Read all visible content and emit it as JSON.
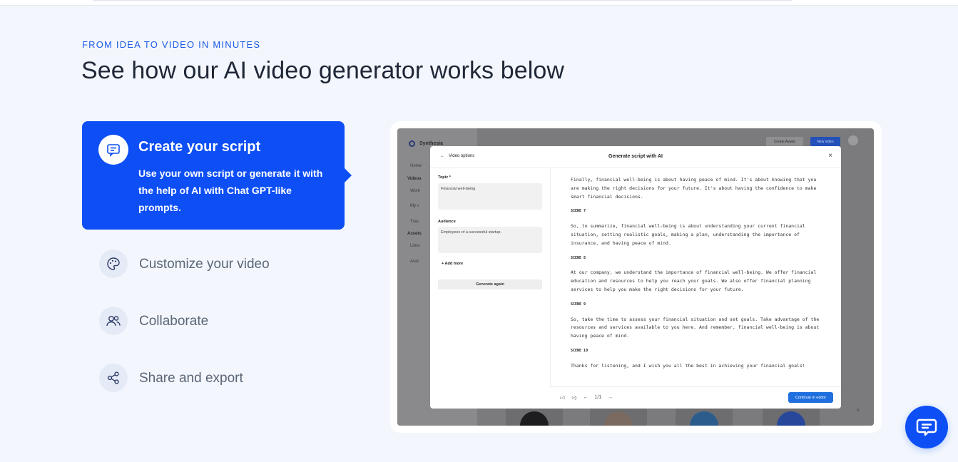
{
  "section": {
    "eyebrow": "FROM IDEA TO VIDEO IN MINUTES",
    "headline": "See how our AI video generator works below"
  },
  "steps": [
    {
      "title": "Create your script",
      "description": "Use your own script or generate it with the help of AI with Chat GPT-like prompts.",
      "icon": "script-message-icon",
      "active": true
    },
    {
      "title": "Customize your video",
      "icon": "palette-icon",
      "active": false
    },
    {
      "title": "Collaborate",
      "icon": "users-icon",
      "active": false
    },
    {
      "title": "Share and export",
      "icon": "share-icon",
      "active": false
    }
  ],
  "mockup": {
    "app_name": "Synthesia",
    "sidebar": {
      "home": "Home",
      "videos_heading": "Videos",
      "workspace": "Work",
      "my_videos": "My v",
      "trash": "Tras",
      "assets_heading": "Assets",
      "library": "Libra",
      "avatars": "Avat"
    },
    "header": {
      "create_avatar": "Create Avatar",
      "new_video": "New video"
    },
    "modal": {
      "back_label": "Video options",
      "title": "Generate script with AI",
      "close": "×",
      "topic_label": "Topic *",
      "topic_value": "Financial well-being",
      "audience_label": "Audience",
      "audience_value": "Employees of a successful startup.",
      "add_more": "Add more",
      "generate_again": "Generate again",
      "script": [
        {
          "type": "para",
          "text": "Finally, financial well-being is about having peace of mind. It's about knowing that you are making the right decisions for your future. It's about having the confidence to make smart financial decisions."
        },
        {
          "type": "scene",
          "text": "SCENE 7"
        },
        {
          "type": "para",
          "text": "So, to summarize, financial well-being is about understanding your current financial situation, setting realistic goals, making a plan, understanding the importance of insurance, and having peace of mind."
        },
        {
          "type": "scene",
          "text": "SCENE 8"
        },
        {
          "type": "para",
          "text": "At our company, we understand the importance of financial well-being. We offer financial education and resources to help you reach your goals. We also offer financial planning services to help you make the right decisions for your future."
        },
        {
          "type": "scene",
          "text": "SCENE 9"
        },
        {
          "type": "para",
          "text": "So, take the time to assess your financial situation and set goals. Take advantage of the resources and services available to you here. And remember, financial well-being is about having peace of mind."
        },
        {
          "type": "scene",
          "text": "SCENE 10"
        },
        {
          "type": "para",
          "text": "Thanks for listening, and I wish you all the best in achieving your financial goals!"
        }
      ],
      "pagination": "1/1",
      "continue_label": "Continue in editor"
    },
    "help": "?"
  },
  "chat": {
    "icon": "chat-bubble-icon"
  },
  "colors": {
    "accent": "#0d4ff5",
    "background": "#f3f7fd",
    "eyebrow": "#1a5ae6"
  }
}
